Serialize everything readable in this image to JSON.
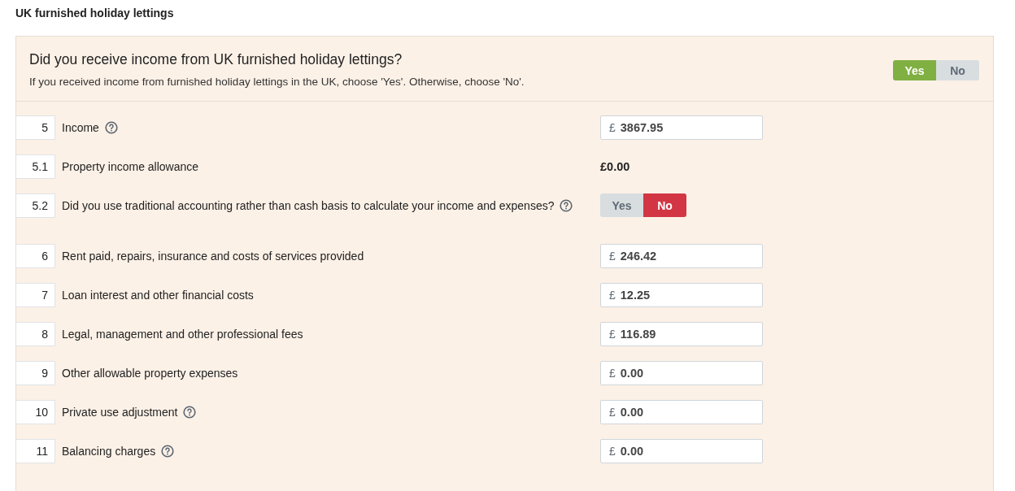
{
  "section_title": "UK furnished holiday lettings",
  "question": {
    "title": "Did you receive income from UK furnished holiday lettings?",
    "hint": "If you received income from furnished holiday lettings in the UK, choose 'Yes'. Otherwise, choose 'No'.",
    "options": [
      {
        "label": "Yes",
        "selected": true
      },
      {
        "label": "No",
        "selected": false
      }
    ]
  },
  "rows": [
    {
      "number": "5",
      "label": "Income",
      "help": true,
      "kind": "money",
      "currency": "£",
      "value": "3867.95"
    },
    {
      "number": "5.1",
      "label": "Property income allowance",
      "help": false,
      "kind": "amount",
      "value": "£0.00"
    },
    {
      "number": "5.2",
      "label": "Did you use traditional accounting rather than cash basis to calculate your income and expenses?",
      "help": true,
      "kind": "yesno",
      "options": [
        {
          "label": "Yes",
          "selected": false
        },
        {
          "label": "No",
          "selected": true
        }
      ]
    },
    {
      "number": "6",
      "label": "Rent paid, repairs, insurance and costs of services provided",
      "help": false,
      "kind": "money",
      "currency": "£",
      "value": "246.42"
    },
    {
      "number": "7",
      "label": "Loan interest and other financial costs",
      "help": false,
      "kind": "money",
      "currency": "£",
      "value": "12.25"
    },
    {
      "number": "8",
      "label": "Legal, management and other professional fees",
      "help": false,
      "kind": "money",
      "currency": "£",
      "value": "116.89"
    },
    {
      "number": "9",
      "label": "Other allowable property expenses",
      "help": false,
      "kind": "money",
      "currency": "£",
      "value": "0.00"
    },
    {
      "number": "10",
      "label": "Private use adjustment",
      "help": true,
      "kind": "money",
      "currency": "£",
      "value": "0.00"
    },
    {
      "number": "11",
      "label": "Balancing charges",
      "help": true,
      "kind": "money",
      "currency": "£",
      "value": "0.00"
    }
  ]
}
